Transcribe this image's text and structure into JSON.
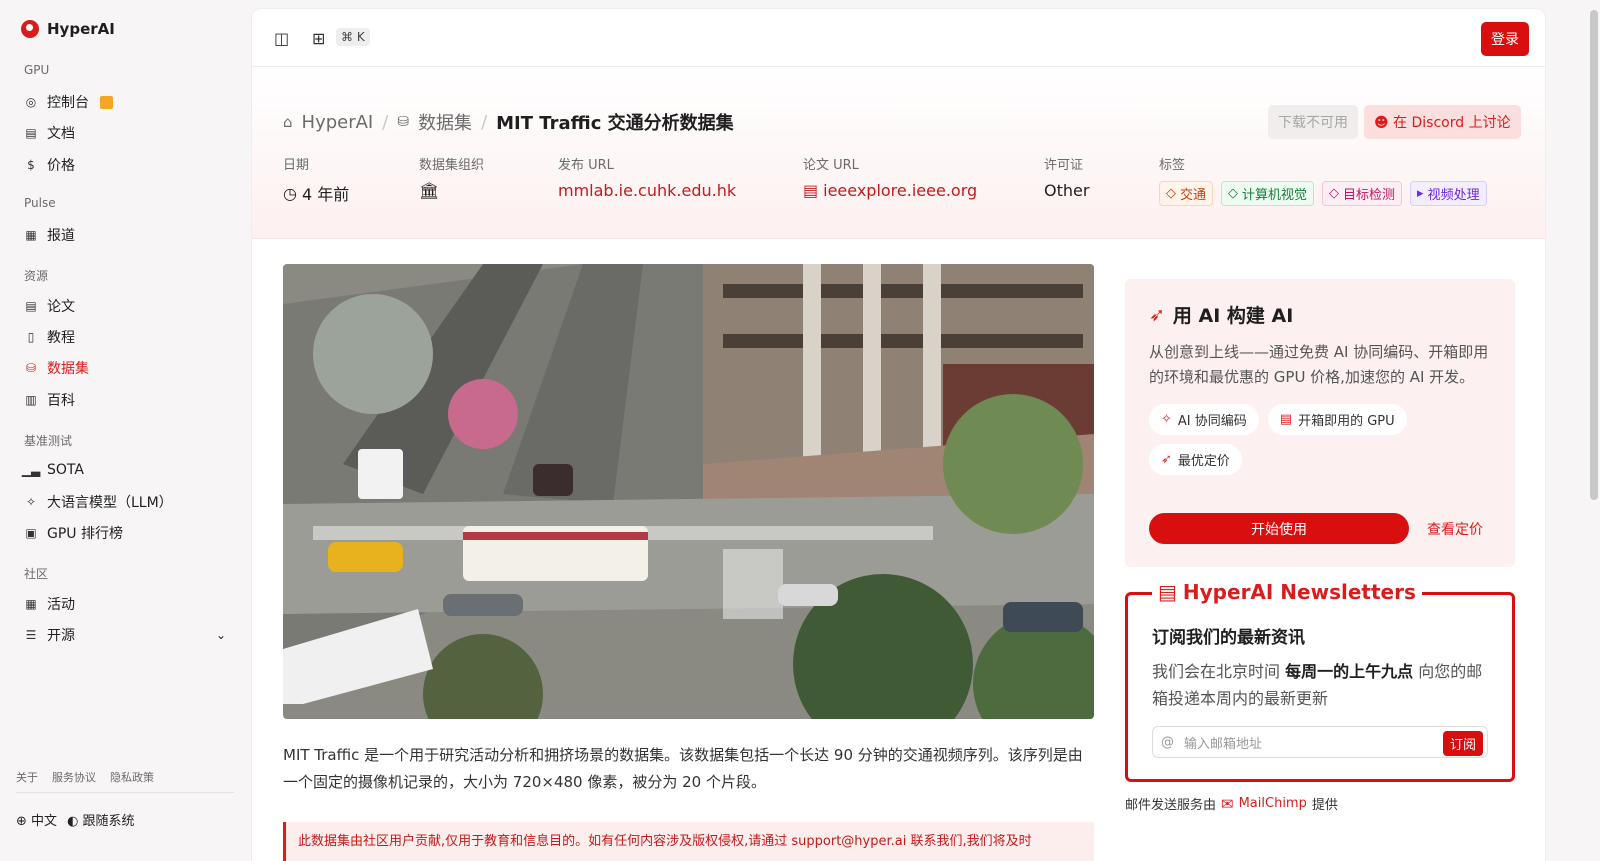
{
  "brand": "HyperAI",
  "sidebar": {
    "sections": [
      {
        "title": "GPU",
        "items": [
          {
            "label": "控制台",
            "icon": "gauge-icon"
          },
          {
            "label": "文档",
            "icon": "doc-icon"
          },
          {
            "label": "价格",
            "icon": "dollar-icon"
          }
        ]
      },
      {
        "title": "Pulse",
        "items": [
          {
            "label": "报道",
            "icon": "news-icon"
          }
        ]
      },
      {
        "title": "资源",
        "items": [
          {
            "label": "论文",
            "icon": "paper-icon"
          },
          {
            "label": "教程",
            "icon": "book-icon"
          },
          {
            "label": "数据集",
            "icon": "database-icon"
          },
          {
            "label": "百科",
            "icon": "wiki-icon"
          }
        ]
      },
      {
        "title": "基准测试",
        "items": [
          {
            "label": "SOTA",
            "icon": "chart-icon"
          },
          {
            "label": "大语言模型（LLM）",
            "icon": "sparkle-icon"
          },
          {
            "label": "GPU 排行榜",
            "icon": "chip-icon"
          }
        ]
      },
      {
        "title": "社区",
        "items": [
          {
            "label": "活动",
            "icon": "calendar-icon"
          },
          {
            "label": "开源",
            "icon": "opensource-icon"
          }
        ]
      }
    ],
    "footer_links": [
      "关于",
      "服务协议",
      "隐私政策"
    ],
    "language": "中文",
    "theme": "跟随系统"
  },
  "topbar": {
    "shortcut": "⌘ K",
    "login": "登录"
  },
  "header": {
    "breadcrumbs": [
      "HyperAI",
      "数据集",
      "MIT Traffic 交通分析数据集"
    ],
    "download": "下载不可用",
    "discord": "在 Discord 上讨论",
    "meta": {
      "date_label": "日期",
      "date_value": "4 年前",
      "org_label": "数据集组织",
      "release_label": "发布 URL",
      "release_value": "mmlab.ie.cuhk.edu.hk",
      "paper_label": "论文 URL",
      "paper_value": "ieeexplore.ieee.org",
      "license_label": "许可证",
      "license_value": "Other",
      "tags_label": "标签"
    },
    "tags": [
      {
        "label": "交通",
        "color": "#c2410c",
        "bg": "#fff3ea"
      },
      {
        "label": "计算机视觉",
        "color": "#15803d",
        "bg": "#eefbf0"
      },
      {
        "label": "目标检测",
        "color": "#be185d",
        "bg": "#fdeef5"
      },
      {
        "label": "视频处理",
        "color": "#6d28d9",
        "bg": "#f3eefe"
      }
    ]
  },
  "content": {
    "description": "MIT Traffic 是一个用于研究活动分析和拥挤场景的数据集。该数据集包括一个长达 90 分钟的交通视频序列。该序列是由一个固定的摄像机记录的，大小为 720×480 像素，被分为 20 个片段。",
    "notice": "此数据集由社区用户贡献,仅用于教育和信息目的。如有任何内容涉及版权侵权,请通过 support@hyper.ai 联系我们,我们将及时"
  },
  "promo": {
    "title": "用 AI 构建 AI",
    "text": "从创意到上线——通过免费 AI 协同编码、开箱即用的环境和最优惠的 GPU 价格,加速您的 AI 开发。",
    "chips": [
      "AI 协同编码",
      "开箱即用的 GPU",
      "最优定价"
    ],
    "start": "开始使用",
    "pricing": "查看定价"
  },
  "newsletter": {
    "title": "HyperAI Newsletters",
    "subtitle": "订阅我们的最新资讯",
    "text_pre": "我们会在北京时间",
    "text_bold": "每周一的上午九点",
    "text_post": "向您的邮箱投递本周内的最新更新",
    "placeholder": "输入邮箱地址",
    "subscribe": "订阅",
    "mailer_pre": "邮件发送服务由",
    "mailer_name": "MailChimp",
    "mailer_post": "提供"
  }
}
